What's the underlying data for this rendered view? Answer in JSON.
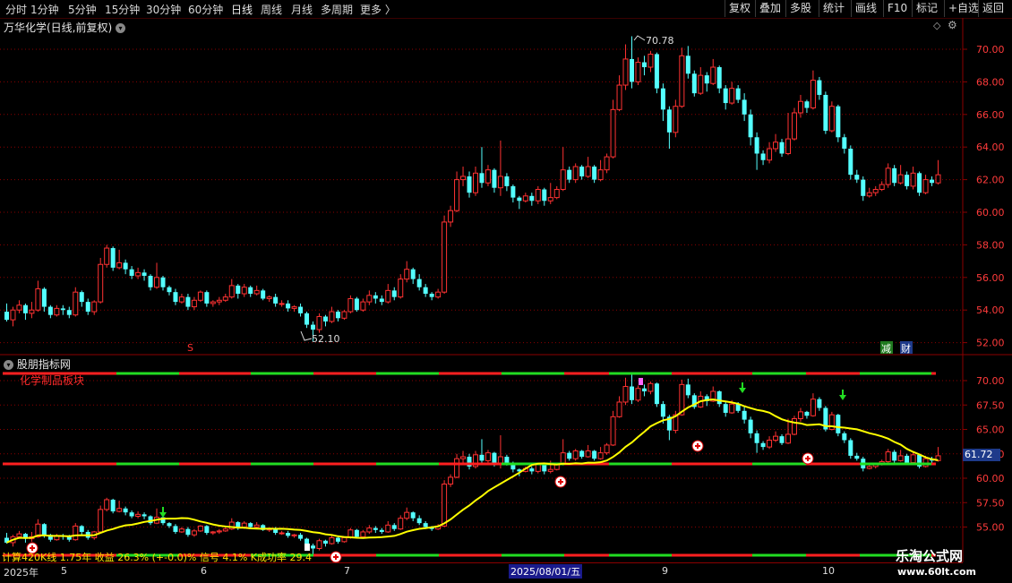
{
  "toolbar": {
    "periods": [
      "分时",
      "1分钟",
      "5分钟",
      "15分钟",
      "30分钟",
      "60分钟",
      "日线",
      "周线",
      "月线",
      "多周期",
      "更多 〉"
    ],
    "active_period": "日线",
    "right_buttons": [
      "复权",
      "叠加",
      "多股",
      "统计",
      "画线",
      "F10",
      "标记",
      "+自选",
      "返回"
    ]
  },
  "main_chart": {
    "title": "万华化学(日线,前复权)",
    "high_label": "70.78",
    "low_label": "52.10",
    "axis_labels": [
      "70.00",
      "68.00",
      "66.00",
      "64.00",
      "62.00",
      "60.00",
      "58.00",
      "56.00",
      "54.00",
      "52.00"
    ],
    "marker_s": "S",
    "marker_reduce": "减",
    "marker_fin": "财"
  },
  "indicator": {
    "title": "股朋指标网",
    "sector_label": "化学制品板块",
    "axis_labels": [
      "70.00",
      "67.50",
      "65.00",
      "62.50",
      "60.00",
      "57.50",
      "55.00"
    ],
    "price_tag": "61.72",
    "stats": "计算420K线 1.75年 收益 26.3% (+-0.0)% 信号 4.1% K成功率 29.4"
  },
  "xaxis": {
    "labels": [
      "2025年",
      "5",
      "6",
      "7",
      "9",
      "10"
    ],
    "cursor_date": "2025/08/01/五"
  },
  "watermark": {
    "line1": "乐淘公式网",
    "line2": "www.60lt.com"
  },
  "colors": {
    "up": "#ff3232",
    "down": "#54ffff",
    "ma": "#ffff00",
    "grid": "#8b0000"
  },
  "candles": [
    [
      53.9,
      53.4,
      54.4,
      53.3
    ],
    [
      53.4,
      54.0,
      54.2,
      53.0
    ],
    [
      54.0,
      54.3,
      54.6,
      53.8
    ],
    [
      54.3,
      53.8,
      54.4,
      53.4
    ],
    [
      53.8,
      54.0,
      54.5,
      53.5
    ],
    [
      54.0,
      55.3,
      55.8,
      53.9
    ],
    [
      55.3,
      54.2,
      55.4,
      53.9
    ],
    [
      54.2,
      53.7,
      54.3,
      53.5
    ],
    [
      53.7,
      54.1,
      54.3,
      53.6
    ],
    [
      54.1,
      54.0,
      54.3,
      53.7
    ],
    [
      54.0,
      53.7,
      54.2,
      53.5
    ],
    [
      53.7,
      55.1,
      55.4,
      53.6
    ],
    [
      55.1,
      54.5,
      55.2,
      54.2
    ],
    [
      54.5,
      53.9,
      54.7,
      53.7
    ],
    [
      53.9,
      54.5,
      54.6,
      53.7
    ],
    [
      54.5,
      56.8,
      57.2,
      54.4
    ],
    [
      56.8,
      57.8,
      58.0,
      56.6
    ],
    [
      57.8,
      56.6,
      57.9,
      56.4
    ],
    [
      56.6,
      56.9,
      57.7,
      56.5
    ],
    [
      56.9,
      56.5,
      57.1,
      56.2
    ],
    [
      56.5,
      56.1,
      56.7,
      55.9
    ],
    [
      56.1,
      56.3,
      56.6,
      55.9
    ],
    [
      56.3,
      56.1,
      56.5,
      55.8
    ],
    [
      56.1,
      55.4,
      56.2,
      55.2
    ],
    [
      55.4,
      56.0,
      56.9,
      55.3
    ],
    [
      56.0,
      55.4,
      56.1,
      55.2
    ],
    [
      55.4,
      55.1,
      55.5,
      54.9
    ],
    [
      55.1,
      54.5,
      55.3,
      54.3
    ],
    [
      54.5,
      54.8,
      55.0,
      54.4
    ],
    [
      54.8,
      54.2,
      55.0,
      54.0
    ],
    [
      54.2,
      54.6,
      54.8,
      54.0
    ],
    [
      54.6,
      55.1,
      55.2,
      54.5
    ],
    [
      55.1,
      54.4,
      55.2,
      54.2
    ],
    [
      54.4,
      54.5,
      54.6,
      54.2
    ],
    [
      54.5,
      54.6,
      54.8,
      54.3
    ],
    [
      54.6,
      54.8,
      55.0,
      54.5
    ],
    [
      54.8,
      55.5,
      55.9,
      54.7
    ],
    [
      55.5,
      55.0,
      55.6,
      54.7
    ],
    [
      55.0,
      55.4,
      55.6,
      54.8
    ],
    [
      55.4,
      55.0,
      55.5,
      54.8
    ],
    [
      55.0,
      55.2,
      55.5,
      54.9
    ],
    [
      55.2,
      54.7,
      55.3,
      54.6
    ],
    [
      54.7,
      54.8,
      54.9,
      54.5
    ],
    [
      54.8,
      54.4,
      55.0,
      54.2
    ],
    [
      54.4,
      54.4,
      54.6,
      54.2
    ],
    [
      54.4,
      54.1,
      54.6,
      53.9
    ],
    [
      54.1,
      54.2,
      54.3,
      53.9
    ],
    [
      54.2,
      53.8,
      54.4,
      53.6
    ],
    [
      53.8,
      53.1,
      53.9,
      52.9
    ],
    [
      53.1,
      52.8,
      53.3,
      52.1
    ],
    [
      52.8,
      53.6,
      53.8,
      52.6
    ],
    [
      53.6,
      53.3,
      53.7,
      53.0
    ],
    [
      53.3,
      53.9,
      54.2,
      53.2
    ],
    [
      53.9,
      53.5,
      54.0,
      53.3
    ],
    [
      53.5,
      53.9,
      54.0,
      53.4
    ],
    [
      53.9,
      54.7,
      54.9,
      53.8
    ],
    [
      54.7,
      54.0,
      54.8,
      53.9
    ],
    [
      54.0,
      54.5,
      54.7,
      53.9
    ],
    [
      54.5,
      54.9,
      55.2,
      54.3
    ],
    [
      54.9,
      54.7,
      55.1,
      54.4
    ],
    [
      54.7,
      54.5,
      54.9,
      54.3
    ],
    [
      54.5,
      55.2,
      55.6,
      54.4
    ],
    [
      55.2,
      54.8,
      55.4,
      54.6
    ],
    [
      54.8,
      55.9,
      56.2,
      54.7
    ],
    [
      55.9,
      56.5,
      57.0,
      55.7
    ],
    [
      56.5,
      55.9,
      56.6,
      55.6
    ],
    [
      55.9,
      55.4,
      56.2,
      55.2
    ],
    [
      55.4,
      55.0,
      55.6,
      54.8
    ],
    [
      55.0,
      54.8,
      55.1,
      54.6
    ],
    [
      54.8,
      55.1,
      55.3,
      54.7
    ],
    [
      55.1,
      59.4,
      59.8,
      55.0
    ],
    [
      59.4,
      60.1,
      60.4,
      59.1
    ],
    [
      60.1,
      62.0,
      62.5,
      60.0
    ],
    [
      62.0,
      62.2,
      62.8,
      61.6
    ],
    [
      62.2,
      61.2,
      62.5,
      60.9
    ],
    [
      61.2,
      62.4,
      62.8,
      61.0
    ],
    [
      62.4,
      61.8,
      64.0,
      61.5
    ],
    [
      61.8,
      62.6,
      62.9,
      61.6
    ],
    [
      62.6,
      61.5,
      62.7,
      61.2
    ],
    [
      61.5,
      62.2,
      64.4,
      61.0
    ],
    [
      62.2,
      61.6,
      62.4,
      61.3
    ],
    [
      61.6,
      60.9,
      61.7,
      60.6
    ],
    [
      60.9,
      60.7,
      61.0,
      60.2
    ],
    [
      60.7,
      61.0,
      61.2,
      60.6
    ],
    [
      61.0,
      60.7,
      61.2,
      60.4
    ],
    [
      60.7,
      61.4,
      61.6,
      60.5
    ],
    [
      61.4,
      60.7,
      61.5,
      60.4
    ],
    [
      60.7,
      60.9,
      61.8,
      60.5
    ],
    [
      60.9,
      61.4,
      61.6,
      60.8
    ],
    [
      61.4,
      62.6,
      64.0,
      61.3
    ],
    [
      62.6,
      62.0,
      62.8,
      61.8
    ],
    [
      62.0,
      62.8,
      63.0,
      61.8
    ],
    [
      62.8,
      62.2,
      62.9,
      62.0
    ],
    [
      62.2,
      62.8,
      63.4,
      62.1
    ],
    [
      62.8,
      62.0,
      62.9,
      61.8
    ],
    [
      62.0,
      62.6,
      63.2,
      61.9
    ],
    [
      62.6,
      63.4,
      63.6,
      62.4
    ],
    [
      63.4,
      66.3,
      66.9,
      63.3
    ],
    [
      66.3,
      67.8,
      68.4,
      66.2
    ],
    [
      67.8,
      69.4,
      70.3,
      67.5
    ],
    [
      69.4,
      68.0,
      70.8,
      67.6
    ],
    [
      68.0,
      69.2,
      69.5,
      67.8
    ],
    [
      69.2,
      68.9,
      69.6,
      68.4
    ],
    [
      68.9,
      69.7,
      69.9,
      68.6
    ],
    [
      69.7,
      67.6,
      69.8,
      67.3
    ],
    [
      67.6,
      66.3,
      67.9,
      65.6
    ],
    [
      66.3,
      64.9,
      66.5,
      63.9
    ],
    [
      64.9,
      66.5,
      66.9,
      64.6
    ],
    [
      66.5,
      69.6,
      70.1,
      66.4
    ],
    [
      69.6,
      68.5,
      70.2,
      68.2
    ],
    [
      68.5,
      67.3,
      68.7,
      67.1
    ],
    [
      67.3,
      68.4,
      68.9,
      67.2
    ],
    [
      68.4,
      67.9,
      68.6,
      67.4
    ],
    [
      67.9,
      68.9,
      69.4,
      67.8
    ],
    [
      68.9,
      67.6,
      69.0,
      67.3
    ],
    [
      67.6,
      66.7,
      67.8,
      66.3
    ],
    [
      66.7,
      67.6,
      68.0,
      66.6
    ],
    [
      67.6,
      66.9,
      67.8,
      66.7
    ],
    [
      66.9,
      66.0,
      67.3,
      65.6
    ],
    [
      66.0,
      64.6,
      66.3,
      64.1
    ],
    [
      64.6,
      63.6,
      64.9,
      62.6
    ],
    [
      63.6,
      63.2,
      63.8,
      62.9
    ],
    [
      63.2,
      63.9,
      64.3,
      63.0
    ],
    [
      63.9,
      64.3,
      64.8,
      63.7
    ],
    [
      64.3,
      63.6,
      64.5,
      63.4
    ],
    [
      63.6,
      64.5,
      66.1,
      63.5
    ],
    [
      64.5,
      66.1,
      66.4,
      64.4
    ],
    [
      66.1,
      66.8,
      67.2,
      65.8
    ],
    [
      66.8,
      66.4,
      66.9,
      66.1
    ],
    [
      66.4,
      68.1,
      68.7,
      66.3
    ],
    [
      68.1,
      67.2,
      68.3,
      66.9
    ],
    [
      67.2,
      65.0,
      67.4,
      64.8
    ],
    [
      65.0,
      66.5,
      66.8,
      64.9
    ],
    [
      66.5,
      64.6,
      66.6,
      64.3
    ],
    [
      64.6,
      63.9,
      64.8,
      63.6
    ],
    [
      63.9,
      62.3,
      64.1,
      62.0
    ],
    [
      62.3,
      62.0,
      62.6,
      61.8
    ],
    [
      62.0,
      61.0,
      62.2,
      60.7
    ],
    [
      61.0,
      61.2,
      61.5,
      60.9
    ],
    [
      61.2,
      61.4,
      61.6,
      61.0
    ],
    [
      61.4,
      61.7,
      61.9,
      61.3
    ],
    [
      61.7,
      62.7,
      63.0,
      61.5
    ],
    [
      62.7,
      61.8,
      62.9,
      61.6
    ],
    [
      61.8,
      62.3,
      62.9,
      61.7
    ],
    [
      62.3,
      61.6,
      62.5,
      61.4
    ],
    [
      61.6,
      62.4,
      62.8,
      61.4
    ],
    [
      62.4,
      61.2,
      62.5,
      61.0
    ],
    [
      61.2,
      62.0,
      62.3,
      61.1
    ],
    [
      62.0,
      61.8,
      62.2,
      61.6
    ],
    [
      61.8,
      62.3,
      63.2,
      61.7
    ]
  ]
}
